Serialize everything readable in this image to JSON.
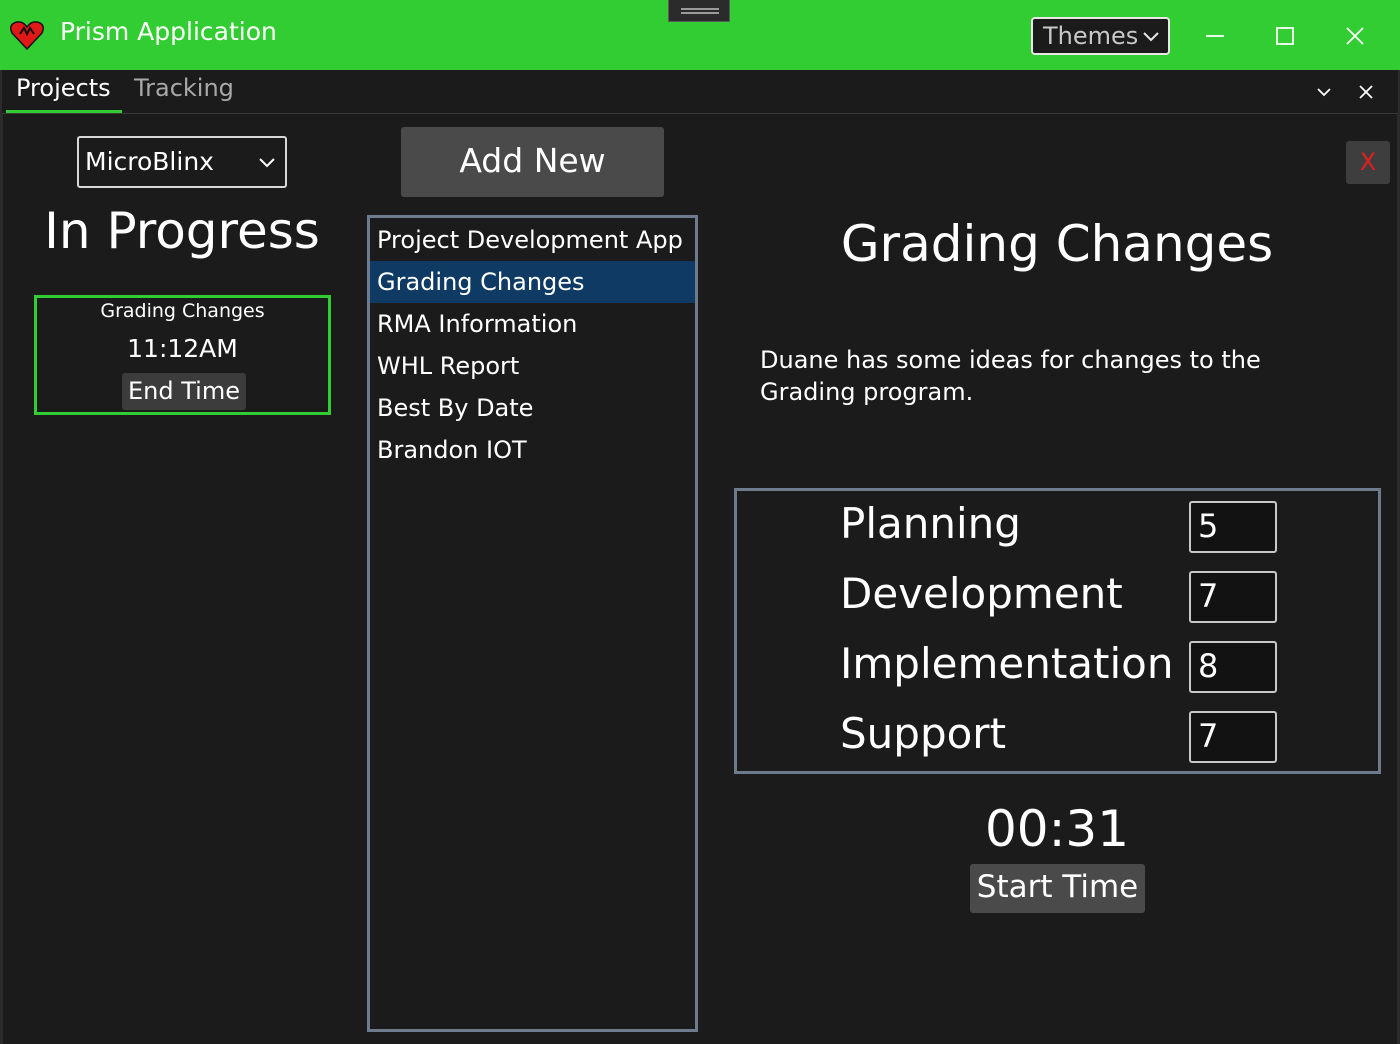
{
  "window": {
    "title": "Prism Application",
    "themes_label": "Themes",
    "accent_color": "#32cd32",
    "icons": [
      "app-heart-icon",
      "chevron-down-icon",
      "minimize-icon",
      "maximize-icon",
      "close-icon",
      "drag-handle-icon"
    ]
  },
  "tabs": {
    "items": [
      {
        "label": "Projects",
        "selected": true
      },
      {
        "label": "Tracking",
        "selected": false
      }
    ]
  },
  "left": {
    "company_selected": "MicroBlinx",
    "in_progress_title": "In Progress",
    "active": {
      "name": "Grading Changes",
      "time": "11:12AM",
      "end_label": "End Time"
    }
  },
  "middle": {
    "add_new_label": "Add New",
    "projects": [
      "Project Development App",
      "Grading Changes",
      "RMA Information",
      "WHL Report",
      "Best By Date",
      "Brandon IOT"
    ],
    "selected_index": 1,
    "selection_color": "#0e3a63"
  },
  "detail": {
    "close_label": "X",
    "title": "Grading Changes",
    "description": "Duane has some ideas for changes to the Grading program.",
    "phases": [
      {
        "label": "Planning",
        "value": "5"
      },
      {
        "label": "Development",
        "value": "7"
      },
      {
        "label": "Implementation",
        "value": "8"
      },
      {
        "label": "Support",
        "value": "7"
      }
    ],
    "timer": "00:31",
    "start_label": "Start Time"
  }
}
